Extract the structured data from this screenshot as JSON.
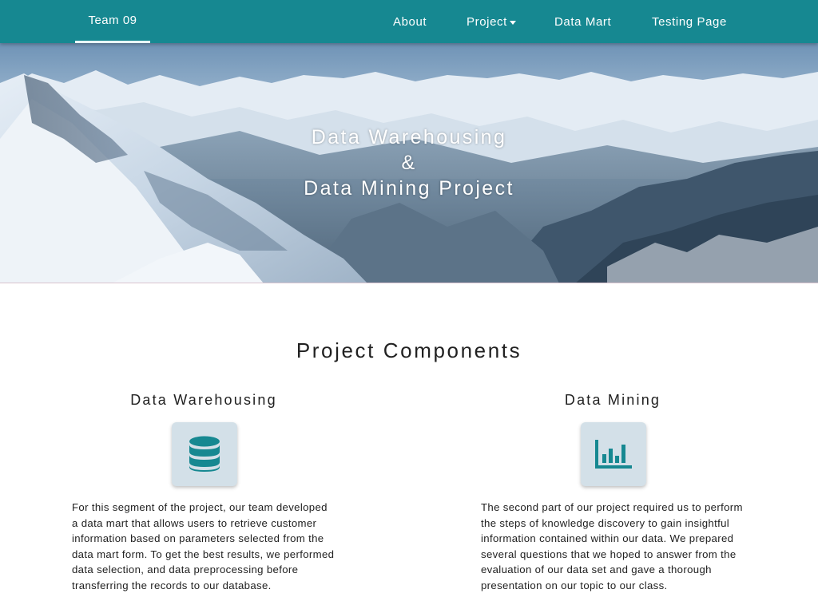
{
  "navbar": {
    "brand": "Team 09",
    "items": [
      {
        "label": "About"
      },
      {
        "label": "Project"
      },
      {
        "label": "Data Mart"
      },
      {
        "label": "Testing Page"
      }
    ]
  },
  "hero": {
    "title_line1": "Data Warehousing",
    "title_line2": "&",
    "title_line3": "Data Mining Project"
  },
  "components": {
    "title": "Project Components",
    "warehousing": {
      "title": "Data Warehousing",
      "icon": "database-icon",
      "text": "For this segment of the project, our team developed a data mart that allows users to retrieve customer information based on parameters selected from the data mart form. To get the best results, we performed data selection, and data preprocessing before transferring the records to our database."
    },
    "mining": {
      "title": "Data Mining",
      "icon": "bar-chart-icon",
      "text": "The second part of our project required us to perform the steps of knowledge discovery to gain insightful information contained within our data. We prepared several questions that we hoped to answer from the evaluation of our data set and gave a thorough presentation on our topic to our class."
    }
  },
  "colors": {
    "navbar": "#168891",
    "accent_icon": "#168891",
    "icon_tile": "#d3e0e8"
  }
}
